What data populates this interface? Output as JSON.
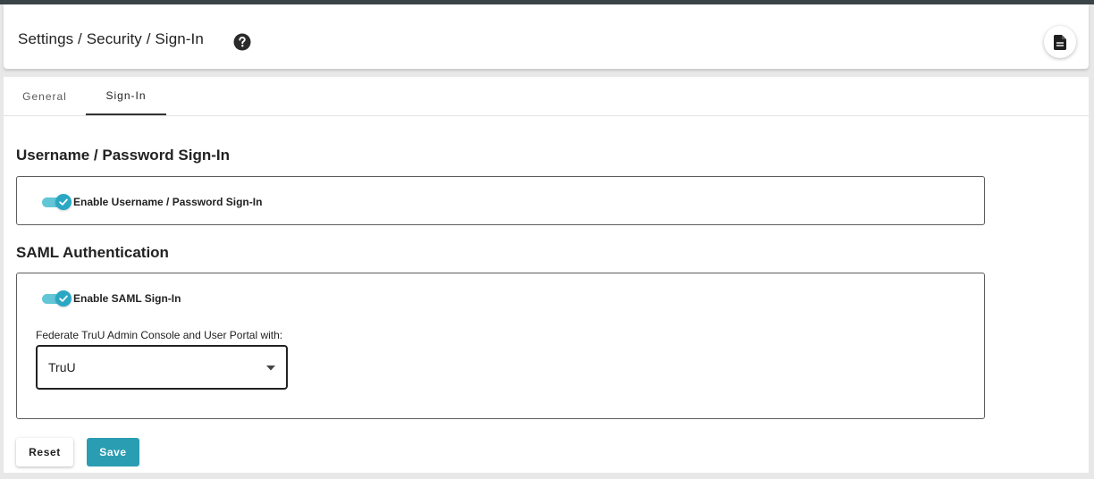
{
  "header": {
    "breadcrumb": "Settings / Security / Sign-In",
    "help_icon": "help-circle-icon",
    "doc_icon": "document-icon"
  },
  "tabs": [
    {
      "label": "General",
      "active": false
    },
    {
      "label": "Sign-In",
      "active": true
    }
  ],
  "username_section": {
    "title": "Username / Password Sign-In",
    "toggle_label": "Enable Username / Password Sign-In",
    "toggle_on": true
  },
  "saml_section": {
    "title": "SAML Authentication",
    "toggle_label": "Enable SAML Sign-In",
    "toggle_on": true,
    "federate_label": "Federate TruU Admin Console and User Portal with:",
    "federate_value": "TruU"
  },
  "actions": {
    "reset_label": "Reset",
    "save_label": "Save"
  },
  "colors": {
    "accent": "#2a9db2",
    "toggle_track": "#62c6d6",
    "toggle_knob": "#2aa7c4",
    "top_strip": "#3a4347"
  }
}
